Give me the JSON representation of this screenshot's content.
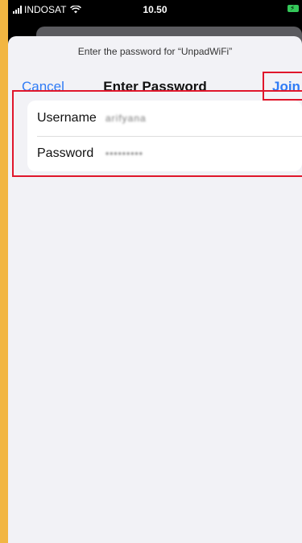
{
  "status_bar": {
    "carrier": "INDOSAT",
    "time": "10.50",
    "icons": [
      "signal-icon",
      "wifi-icon",
      "battery-charging-icon"
    ]
  },
  "dialog": {
    "prompt": "Enter the password for “UnpadWiFi”",
    "cancel_label": "Cancel",
    "title": "Enter Password",
    "join_label": "Join"
  },
  "form": {
    "username_label": "Username",
    "username_value": "arifyana",
    "password_label": "Password",
    "password_value": "•••••••••"
  },
  "colors": {
    "accent": "#2f7bf5",
    "highlight": "#e0162b",
    "background": "#f2b642"
  }
}
